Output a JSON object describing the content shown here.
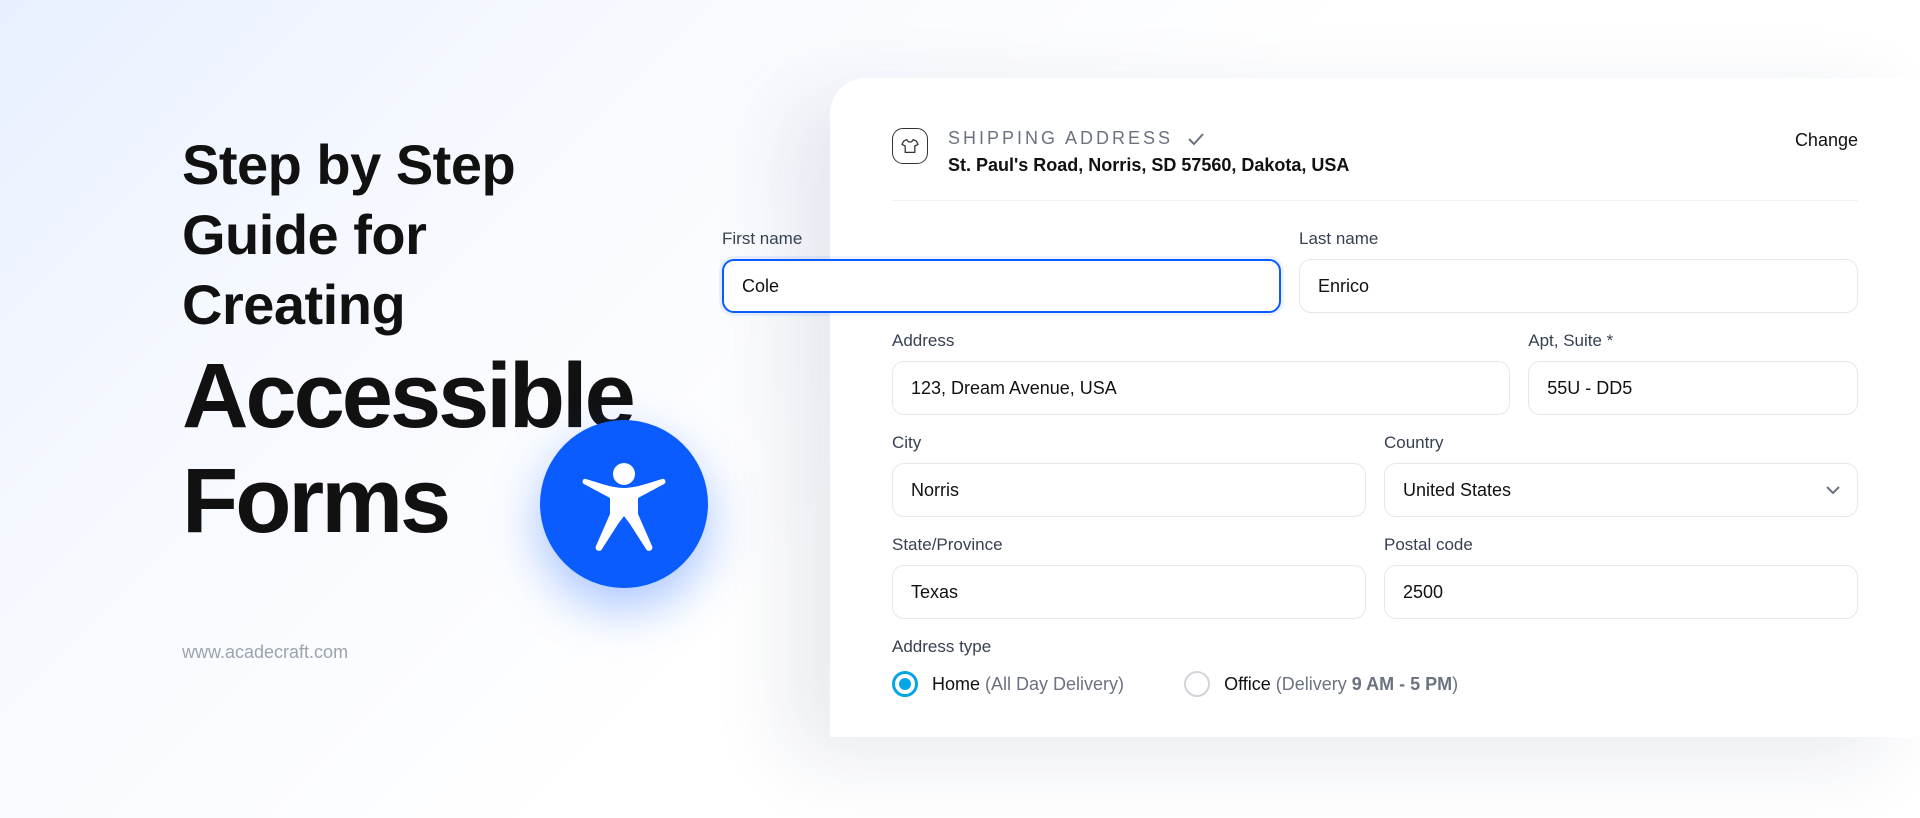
{
  "headline": {
    "line1": "Step by Step",
    "line2": "Guide for Creating",
    "big1": "Accessible",
    "big2": "Forms"
  },
  "website": "www.acadecraft.com",
  "colors": {
    "accent": "#0b5cff",
    "radio": "#06a6e6"
  },
  "form": {
    "header": {
      "title": "SHIPPING ADDRESS",
      "summary": "St. Paul's Road, Norris, SD 57560, Dakota, USA",
      "change": "Change"
    },
    "fields": {
      "first_name": {
        "label": "First name",
        "value": "Cole"
      },
      "last_name": {
        "label": "Last name",
        "value": "Enrico"
      },
      "address": {
        "label": "Address",
        "value": "123, Dream Avenue, USA"
      },
      "apt": {
        "label": "Apt, Suite *",
        "value": "55U - DD5"
      },
      "city": {
        "label": "City",
        "value": "Norris"
      },
      "country": {
        "label": "Country",
        "value": "United States"
      },
      "state": {
        "label": "State/Province",
        "value": "Texas"
      },
      "postal": {
        "label": "Postal code",
        "value": "2500"
      }
    },
    "address_type": {
      "label": "Address type",
      "options": [
        {
          "name": "Home",
          "meta": "(All Day Delivery)",
          "selected": true
        },
        {
          "name": "Office",
          "meta_prefix": "(Delivery ",
          "meta_bold": "9 AM - 5 PM",
          "meta_suffix": ")",
          "selected": false
        }
      ]
    }
  }
}
